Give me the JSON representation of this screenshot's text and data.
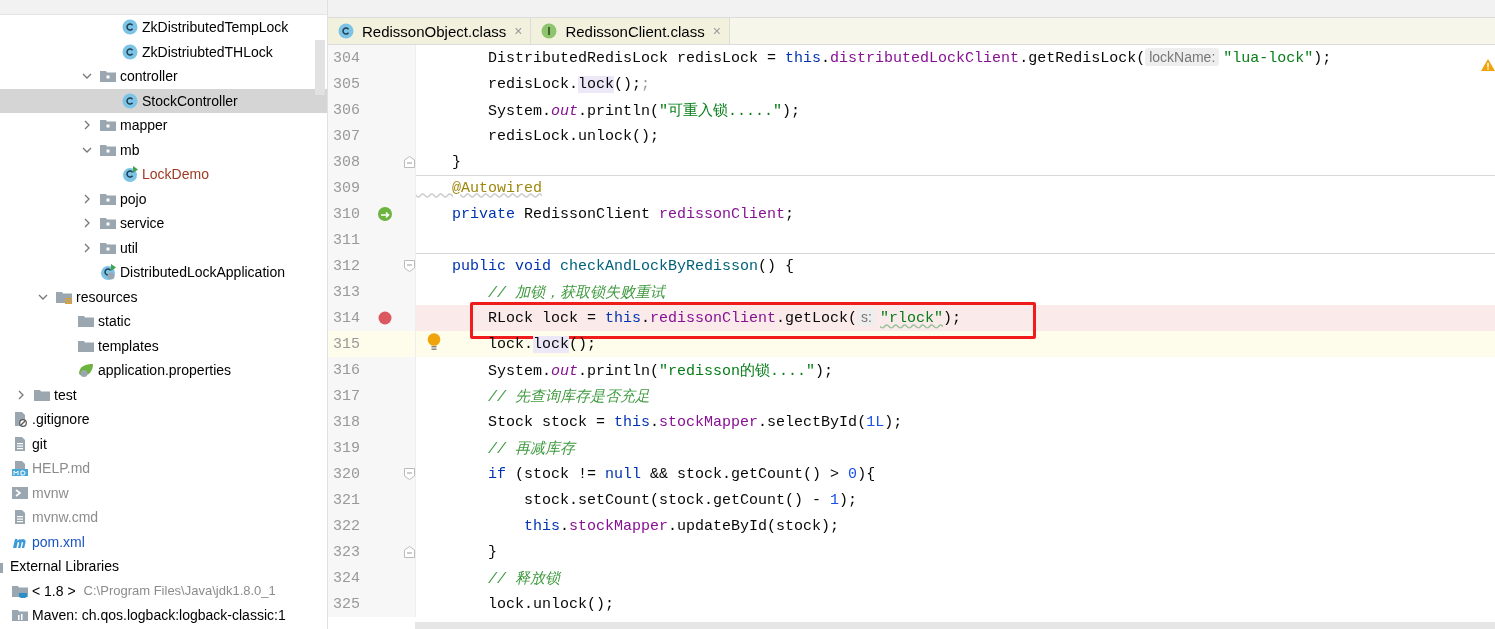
{
  "project_tree": [
    {
      "children": [
        {
          "children": [
            {
              "children": [
                {
                  "children": [
                    {
                      "children": [
                        {
                          "children": [
                            {
                              "label": "ZkDistributedTempLock",
                              "kind": "class",
                              "selected": false,
                              "color": "#000000"
                            },
                            {
                              "label": "ZkDistriubtedTHLock",
                              "kind": "class",
                              "selected": false,
                              "color": "#000000"
                            }
                          ]
                        },
                        {
                          "label": "controller",
                          "kind": "package",
                          "expanded": true,
                          "selected": false,
                          "color": "#000000",
                          "children": [
                            {
                              "label": "StockController",
                              "kind": "class",
                              "selected": true,
                              "color": "#000000"
                            }
                          ]
                        },
                        {
                          "label": "mapper",
                          "kind": "package",
                          "expanded": false,
                          "selected": false,
                          "color": "#000000"
                        },
                        {
                          "label": "mb",
                          "kind": "package",
                          "expanded": true,
                          "selected": false,
                          "color": "#000000",
                          "children": [
                            {
                              "label": "LockDemo",
                              "kind": "runnable-class",
                              "selected": false,
                              "color": "#9c3a22"
                            }
                          ]
                        },
                        {
                          "label": "pojo",
                          "kind": "package",
                          "expanded": false,
                          "selected": false,
                          "color": "#000000"
                        },
                        {
                          "label": "service",
                          "kind": "package",
                          "expanded": false,
                          "selected": false,
                          "color": "#000000"
                        },
                        {
                          "label": "util",
                          "kind": "package",
                          "expanded": false,
                          "selected": false,
                          "color": "#000000"
                        },
                        {
                          "label": "DistributedLockApplication",
                          "kind": "spring-app",
                          "selected": false,
                          "color": "#000000"
                        }
                      ]
                    }
                  ]
                },
                {
                  "label": "resources",
                  "kind": "resources",
                  "expanded": true,
                  "selected": false,
                  "color": "#000000",
                  "children": [
                    {
                      "label": "static",
                      "kind": "folder",
                      "selected": false,
                      "color": "#000000"
                    },
                    {
                      "label": "templates",
                      "kind": "folder",
                      "selected": false,
                      "color": "#000000"
                    },
                    {
                      "label": "application.properties",
                      "kind": "spring-config",
                      "selected": false,
                      "color": "#000000"
                    }
                  ]
                }
              ]
            },
            {
              "label": "test",
              "kind": "folder",
              "expanded": false,
              "selected": false,
              "color": "#000000"
            }
          ]
        },
        {
          "label": ".gitignore",
          "kind": "ignore-file",
          "selected": false,
          "color": "#000000"
        },
        {
          "label": "git",
          "kind": "text-file",
          "selected": false,
          "color": "#000000"
        },
        {
          "label": "HELP.md",
          "kind": "markdown",
          "selected": false,
          "color": "#8c8c8c"
        },
        {
          "label": "mvnw",
          "kind": "shell",
          "selected": false,
          "color": "#8c8c8c"
        },
        {
          "label": "mvnw.cmd",
          "kind": "text-file",
          "selected": false,
          "color": "#8c8c8c"
        },
        {
          "label": "pom.xml",
          "kind": "maven",
          "selected": false,
          "color": "#1a54c4"
        }
      ]
    },
    {
      "label": "External Libraries",
      "kind": "libraries",
      "selected": false,
      "color": "#000000",
      "children": [
        {
          "label": "< 1.8 >",
          "detail": "C:\\Program Files\\Java\\jdk1.8.0_1",
          "kind": "jdk",
          "selected": false,
          "color": "#000000"
        },
        {
          "label": "Maven: ch.qos.logback:logback-classic:1",
          "kind": "library",
          "selected": false,
          "color": "#000000"
        }
      ]
    }
  ],
  "editor_tabs": [
    {
      "label": "RedissonObject.class",
      "kind": "class",
      "close": "×"
    },
    {
      "label": "RedissonClient.class",
      "kind": "interface",
      "close": "×"
    }
  ],
  "code_lines": [
    {
      "number": "304",
      "kind": "code",
      "current": false,
      "separator": false,
      "boxed": false,
      "fold_start": false,
      "fold_end": false,
      "tokens": [
        {
          "kind": "plain",
          "text": "        DistributedRedisLock redisLock = "
        },
        {
          "kind": "keyword",
          "text": "this"
        },
        {
          "kind": "plain",
          "text": "."
        },
        {
          "kind": "field",
          "text": "distributedLockClient"
        },
        {
          "kind": "plain",
          "text": ".getRedisLock("
        },
        {
          "kind": "hint",
          "text": "lockName:"
        },
        {
          "kind": "string",
          "text": "\"lua-lock\""
        },
        {
          "kind": "plain",
          "text": ");"
        }
      ]
    },
    {
      "number": "305",
      "kind": "code",
      "current": false,
      "separator": false,
      "boxed": false,
      "fold_start": false,
      "fold_end": false,
      "tokens": [
        {
          "kind": "plain",
          "text": "        redisLock."
        },
        {
          "kind": "usage",
          "text": "lock"
        },
        {
          "kind": "plain",
          "text": "();"
        },
        {
          "kind": "dim",
          "text": ";"
        }
      ]
    },
    {
      "number": "306",
      "kind": "code",
      "current": false,
      "separator": false,
      "boxed": false,
      "fold_start": false,
      "fold_end": false,
      "tokens": [
        {
          "kind": "plain",
          "text": "        System."
        },
        {
          "kind": "static",
          "text": "out"
        },
        {
          "kind": "plain",
          "text": ".println("
        },
        {
          "kind": "string",
          "text": "\"可重入锁.....\""
        },
        {
          "kind": "plain",
          "text": ");"
        }
      ]
    },
    {
      "number": "307",
      "kind": "code",
      "current": false,
      "separator": false,
      "boxed": false,
      "fold_start": false,
      "fold_end": false,
      "tokens": [
        {
          "kind": "plain",
          "text": "        redisLock.unlock();"
        }
      ]
    },
    {
      "number": "308",
      "kind": "code",
      "current": false,
      "separator": false,
      "boxed": false,
      "fold_start": false,
      "fold_end": true,
      "tokens": [
        {
          "kind": "plain",
          "text": "    }"
        }
      ]
    },
    {
      "number": "309",
      "kind": "code",
      "current": false,
      "separator": true,
      "boxed": false,
      "fold_start": false,
      "fold_end": false,
      "tokens": [
        {
          "kind": "annotation",
          "text": "    @Autowired"
        }
      ]
    },
    {
      "number": "310",
      "kind": "bean",
      "current": false,
      "separator": false,
      "boxed": false,
      "fold_start": false,
      "fold_end": false,
      "tokens": [
        {
          "kind": "keyword",
          "text": "    private "
        },
        {
          "kind": "plain",
          "text": "RedissonClient "
        },
        {
          "kind": "field",
          "text": "redissonClient"
        },
        {
          "kind": "plain",
          "text": ";"
        }
      ]
    },
    {
      "number": "311",
      "kind": "code",
      "current": false,
      "separator": false,
      "boxed": false,
      "fold_start": false,
      "fold_end": false
    },
    {
      "number": "312",
      "kind": "code",
      "current": false,
      "separator": true,
      "boxed": false,
      "fold_start": true,
      "fold_end": false,
      "tokens": [
        {
          "kind": "keyword",
          "text": "    public void "
        },
        {
          "kind": "method",
          "text": "checkAndLockByRedisson"
        },
        {
          "kind": "plain",
          "text": "() {"
        }
      ]
    },
    {
      "number": "313",
      "kind": "code",
      "current": false,
      "separator": false,
      "boxed": false,
      "fold_start": false,
      "fold_end": false,
      "tokens": [
        {
          "kind": "comment",
          "text": "        // 加锁，获取锁失败重试"
        }
      ]
    },
    {
      "number": "314",
      "kind": "breakpoint",
      "current": false,
      "separator": false,
      "boxed": true,
      "fold_start": false,
      "fold_end": false,
      "tokens": [
        {
          "kind": "plain",
          "text": "        RLock lock = "
        },
        {
          "kind": "keyword",
          "text": "this"
        },
        {
          "kind": "plain",
          "text": "."
        },
        {
          "kind": "field",
          "text": "redissonClient"
        },
        {
          "kind": "plain",
          "text": ".getLock("
        },
        {
          "kind": "hint",
          "text": "s:"
        },
        {
          "kind": "string-typo",
          "text": "\"rlock\""
        },
        {
          "kind": "plain",
          "text": ");"
        }
      ]
    },
    {
      "number": "315",
      "kind": "intention",
      "current": true,
      "separator": false,
      "boxed": false,
      "fold_start": false,
      "fold_end": false,
      "tokens": [
        {
          "kind": "plain",
          "text": "        lock."
        },
        {
          "kind": "usage",
          "text": "lock"
        },
        {
          "kind": "plain",
          "text": "();"
        }
      ]
    },
    {
      "number": "316",
      "kind": "code",
      "current": false,
      "separator": false,
      "boxed": false,
      "fold_start": false,
      "fold_end": false,
      "tokens": [
        {
          "kind": "plain",
          "text": "        System."
        },
        {
          "kind": "static",
          "text": "out"
        },
        {
          "kind": "plain",
          "text": ".println("
        },
        {
          "kind": "string",
          "text": "\"redisson的锁....\""
        },
        {
          "kind": "plain",
          "text": ");"
        }
      ]
    },
    {
      "number": "317",
      "kind": "code",
      "current": false,
      "separator": false,
      "boxed": false,
      "fold_start": false,
      "fold_end": false,
      "tokens": [
        {
          "kind": "comment",
          "text": "        // 先查询库存是否充足"
        }
      ]
    },
    {
      "number": "318",
      "kind": "code",
      "current": false,
      "separator": false,
      "boxed": false,
      "fold_start": false,
      "fold_end": false,
      "tokens": [
        {
          "kind": "plain",
          "text": "        Stock stock = "
        },
        {
          "kind": "keyword",
          "text": "this"
        },
        {
          "kind": "plain",
          "text": "."
        },
        {
          "kind": "field",
          "text": "stockMapper"
        },
        {
          "kind": "plain",
          "text": ".selectById("
        },
        {
          "kind": "number",
          "text": "1L"
        },
        {
          "kind": "plain",
          "text": ");"
        }
      ]
    },
    {
      "number": "319",
      "kind": "code",
      "current": false,
      "separator": false,
      "boxed": false,
      "fold_start": false,
      "fold_end": false,
      "tokens": [
        {
          "kind": "comment",
          "text": "        // 再减库存"
        }
      ]
    },
    {
      "number": "320",
      "kind": "code",
      "current": false,
      "separator": false,
      "boxed": false,
      "fold_start": true,
      "fold_end": false,
      "tokens": [
        {
          "kind": "keyword",
          "text": "        if "
        },
        {
          "kind": "plain",
          "text": "(stock != "
        },
        {
          "kind": "keyword",
          "text": "null"
        },
        {
          "kind": "plain",
          "text": " && stock.getCount() > "
        },
        {
          "kind": "number",
          "text": "0"
        },
        {
          "kind": "plain",
          "text": "){"
        }
      ]
    },
    {
      "number": "321",
      "kind": "code",
      "current": false,
      "separator": false,
      "boxed": false,
      "fold_start": false,
      "fold_end": false,
      "tokens": [
        {
          "kind": "plain",
          "text": "            stock.setCount(stock.getCount() - "
        },
        {
          "kind": "number",
          "text": "1"
        },
        {
          "kind": "plain",
          "text": ");"
        }
      ]
    },
    {
      "number": "322",
      "kind": "code",
      "current": false,
      "separator": false,
      "boxed": false,
      "fold_start": false,
      "fold_end": false,
      "tokens": [
        {
          "kind": "keyword",
          "text": "            this"
        },
        {
          "kind": "plain",
          "text": "."
        },
        {
          "kind": "field",
          "text": "stockMapper"
        },
        {
          "kind": "plain",
          "text": ".updateById(stock);"
        }
      ]
    },
    {
      "number": "323",
      "kind": "code",
      "current": false,
      "separator": false,
      "boxed": false,
      "fold_start": false,
      "fold_end": true,
      "tokens": [
        {
          "kind": "plain",
          "text": "        }"
        }
      ]
    },
    {
      "number": "324",
      "kind": "code",
      "current": false,
      "separator": false,
      "boxed": false,
      "fold_start": false,
      "fold_end": false,
      "tokens": [
        {
          "kind": "comment",
          "text": "        // 释放锁"
        }
      ]
    },
    {
      "number": "325",
      "kind": "code",
      "current": false,
      "separator": false,
      "boxed": false,
      "fold_start": false,
      "fold_end": false,
      "tokens": [
        {
          "kind": "plain",
          "text": "        lock.unlock();"
        }
      ]
    }
  ]
}
